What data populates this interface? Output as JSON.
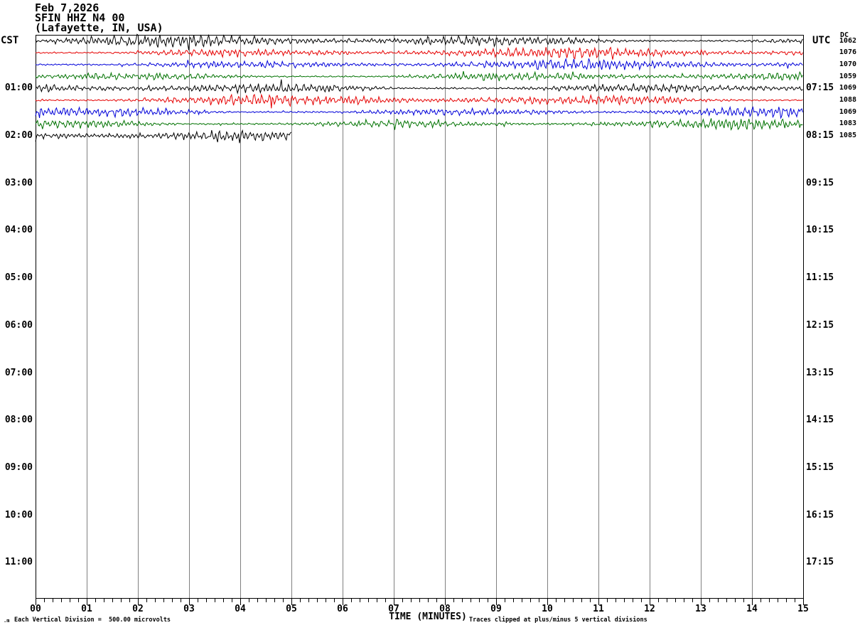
{
  "header": {
    "date": "Feb 7,2026",
    "station": "SFIN HHZ N4 00",
    "location": "(Lafayette, IN, USA)"
  },
  "axes": {
    "left_timezone": "CST",
    "right_timezone": "UTC",
    "dc_header": "DC",
    "left_labels": [
      "01:00",
      "02:00",
      "03:00",
      "04:00",
      "05:00",
      "06:00",
      "07:00",
      "08:00",
      "09:00",
      "10:00",
      "11:00"
    ],
    "right_labels": [
      "07:15",
      "08:15",
      "09:15",
      "10:15",
      "11:15",
      "12:15",
      "13:15",
      "14:15",
      "15:15",
      "16:15",
      "17:15"
    ],
    "x_tick_labels": [
      "00",
      "01",
      "02",
      "03",
      "04",
      "05",
      "06",
      "07",
      "08",
      "09",
      "10",
      "11",
      "12",
      "13",
      "14",
      "15"
    ],
    "x_title": "TIME (MINUTES)"
  },
  "footer": {
    "division_note": "Each Vertical Division =  500.00 microvolts",
    "clip_note": "Traces clipped at plus/minus 5 vertical divisions",
    "watermark": ".m"
  },
  "colors": {
    "black": "#000000",
    "red": "#e60000",
    "blue": "#0000d9",
    "green": "#007200",
    "grid": "#808080",
    "frame": "#000000"
  },
  "chart_data": {
    "type": "line",
    "subtype": "seismogram-helicorder",
    "x_axis": {
      "label": "TIME (MINUTES)",
      "min": 0,
      "max": 15,
      "minutes_per_line": 15,
      "minor_ticks_per_minute": 5
    },
    "y_axis": {
      "volts_per_division": "500.00 microvolts",
      "clip_divisions": 5,
      "lines_per_hour": 4
    },
    "traces": [
      {
        "row": 0,
        "color": "black",
        "start_minute": 0,
        "end_minute": 15,
        "dc": 1062,
        "amplitude": 5.6,
        "seed": 101
      },
      {
        "row": 1,
        "color": "red",
        "start_minute": 0,
        "end_minute": 15,
        "dc": 1076,
        "amplitude": 5.2,
        "seed": 102
      },
      {
        "row": 2,
        "color": "blue",
        "start_minute": 0,
        "end_minute": 15,
        "dc": 1070,
        "amplitude": 5.0,
        "seed": 103
      },
      {
        "row": 3,
        "color": "green",
        "start_minute": 0,
        "end_minute": 15,
        "dc": 1059,
        "amplitude": 4.7,
        "seed": 104
      },
      {
        "row": 4,
        "color": "black",
        "start_minute": 0,
        "end_minute": 15,
        "dc": 1069,
        "amplitude": 5.4,
        "seed": 105
      },
      {
        "row": 5,
        "color": "red",
        "start_minute": 0,
        "end_minute": 15,
        "dc": 1088,
        "amplitude": 5.1,
        "seed": 106
      },
      {
        "row": 6,
        "color": "blue",
        "start_minute": 0,
        "end_minute": 15,
        "dc": 1069,
        "amplitude": 4.9,
        "seed": 107
      },
      {
        "row": 7,
        "color": "green",
        "start_minute": 0,
        "end_minute": 15,
        "dc": 1083,
        "amplitude": 5.1,
        "seed": 108
      },
      {
        "row": 8,
        "color": "black",
        "start_minute": 0,
        "end_minute": 5,
        "dc": 1085,
        "amplitude": 5.0,
        "seed": 109
      }
    ]
  }
}
